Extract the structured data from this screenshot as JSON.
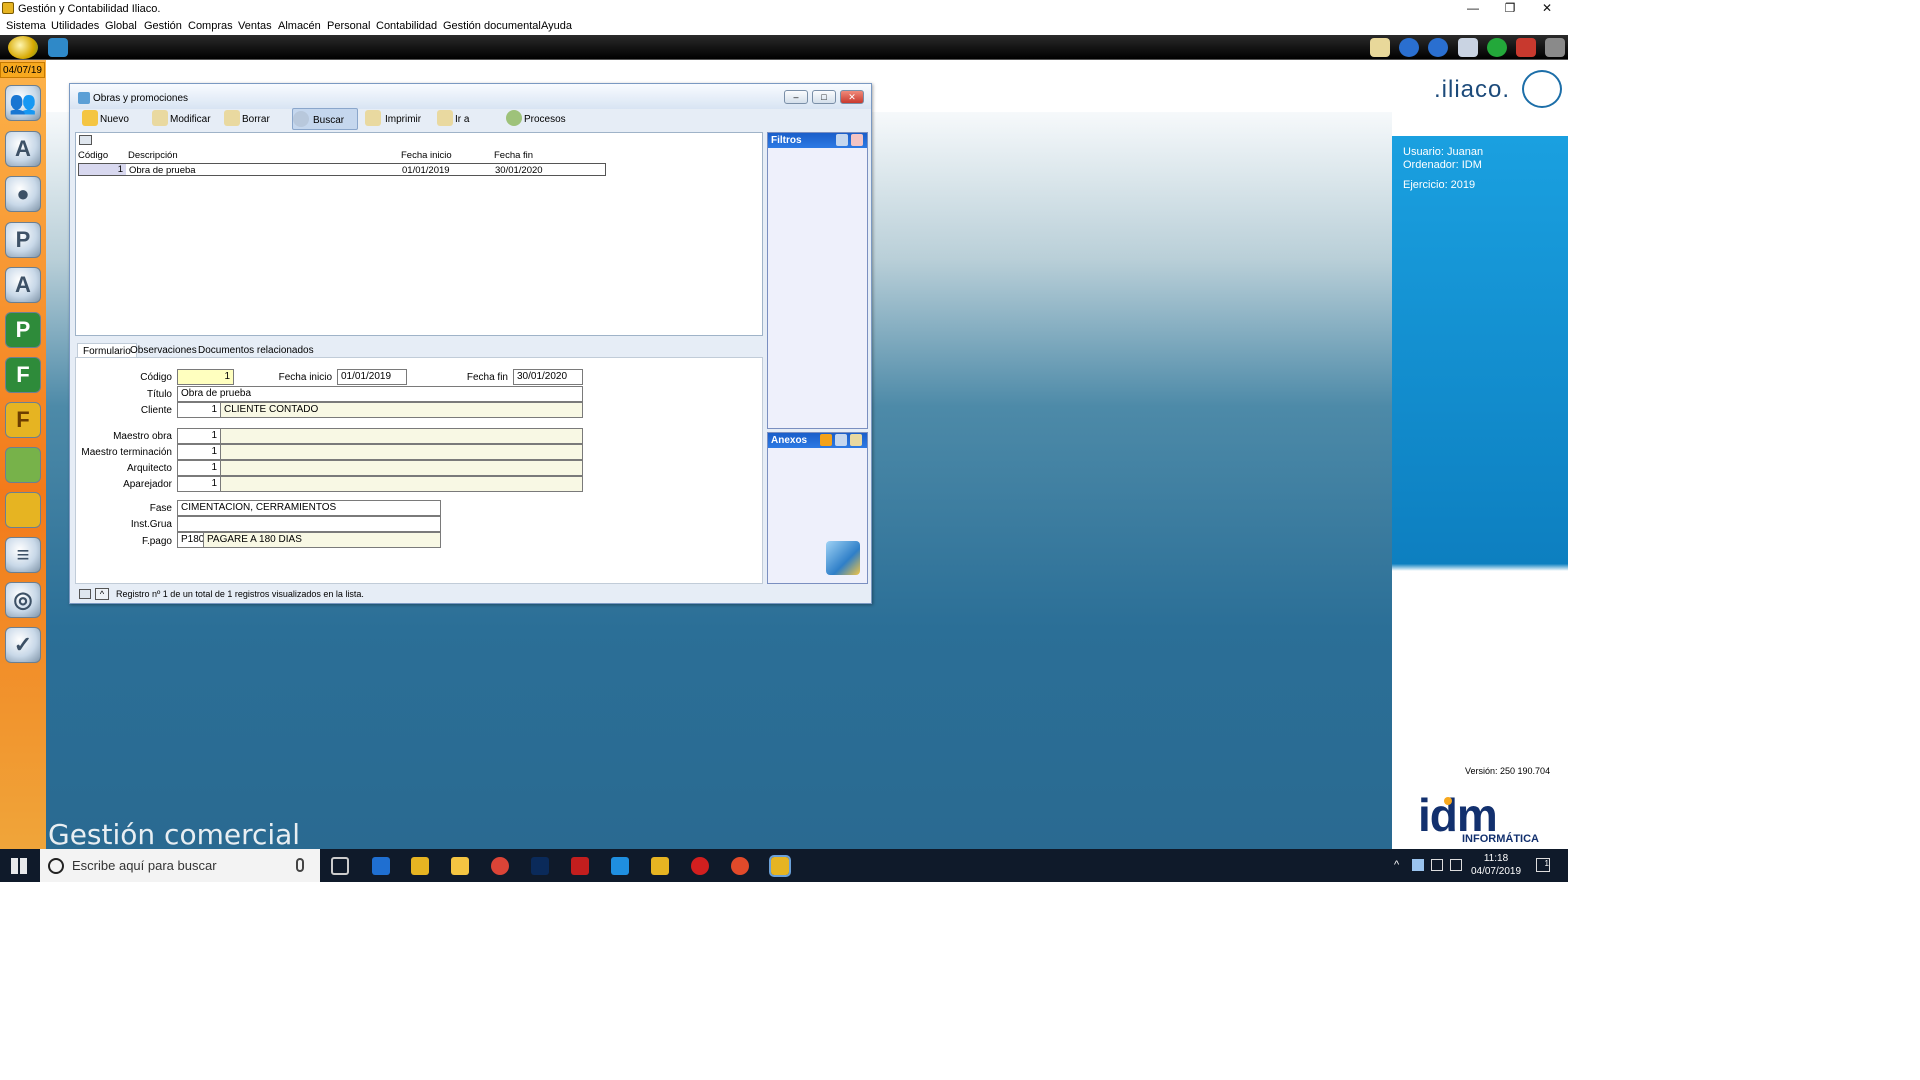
{
  "window": {
    "title": "Gestión y Contabilidad Iliaco.",
    "minimize": "—",
    "restore": "❐",
    "close": "✕"
  },
  "menu": [
    "Sistema",
    "Utilidades",
    "Global",
    "Gestión",
    "Compras",
    "Ventas",
    "Almacén",
    "Personal",
    "Contabilidad",
    "Gestión documental",
    "Ayuda"
  ],
  "sidebar": {
    "date": "04/07/19",
    "icons": [
      "people-icon",
      "letter-a-icon",
      "user-icon",
      "user-p-icon",
      "user-a-icon",
      "p-icon",
      "f-icon",
      "fc-icon",
      "bag-icon",
      "folder-icon",
      "ledger-icon",
      "disc-icon",
      "globe-check-icon"
    ]
  },
  "toolbar_icons": [
    "mail-icon",
    "back-arrow-icon",
    "forward-arrow-icon",
    "window-icon",
    "help-icon",
    "close-window-icon",
    "tools-icon"
  ],
  "brand": {
    "logo": ".iliaco.",
    "section": "Gestión comercial",
    "version": "Versión: 250 190.704",
    "idm": "idm",
    "idm_sub": "INFORMÁTICA"
  },
  "session": {
    "user": "Usuario: Juanan",
    "computer": "Ordenador: IDM",
    "year": "Ejercicio: 2019"
  },
  "dialog": {
    "title": "Obras y promociones",
    "buttons": {
      "new": "Nuevo",
      "edit": "Modificar",
      "delete": "Borrar",
      "search": "Buscar",
      "print": "Imprimir",
      "goto": "Ir a",
      "processes": "Procesos"
    },
    "list": {
      "headers": [
        "Código",
        "Descripción",
        "Fecha inicio",
        "Fecha fin"
      ],
      "rows": [
        [
          "1",
          "Obra de prueba",
          "01/01/2019",
          "30/01/2020"
        ]
      ]
    },
    "filters_title": "Filtros",
    "attachments_title": "Anexos",
    "tabs": [
      "Formulario",
      "Observaciones",
      "Documentos relacionados"
    ],
    "form": {
      "codigo_label": "Código",
      "codigo": "1",
      "fecha_inicio_label": "Fecha inicio",
      "fecha_inicio": "01/01/2019",
      "fecha_fin_label": "Fecha fin",
      "fecha_fin": "30/01/2020",
      "titulo_label": "Título",
      "titulo": "Obra de prueba",
      "cliente_label": "Cliente",
      "cliente_code": "1",
      "cliente_name": "CLIENTE CONTADO",
      "maestro_obra_label": "Maestro obra",
      "maestro_obra": "1",
      "maestro_term_label": "Maestro terminación",
      "maestro_term": "1",
      "arquitecto_label": "Arquitecto",
      "arquitecto": "1",
      "aparejador_label": "Aparejador",
      "aparejador": "1",
      "fase_label": "Fase",
      "fase": "CIMENTACION, CERRAMIENTOS",
      "grua_label": "Inst.Grua",
      "grua": "",
      "fpago_label": "F.pago",
      "fpago_code": "P180",
      "fpago_name": "PAGARE A 180 DIAS"
    },
    "status": "Registro nº 1 de un total de 1 registros visualizados en la lista."
  },
  "taskbar": {
    "search_placeholder": "Escribe aquí para buscar",
    "time": "11:18",
    "date": "04/07/2019",
    "notif": "1"
  }
}
